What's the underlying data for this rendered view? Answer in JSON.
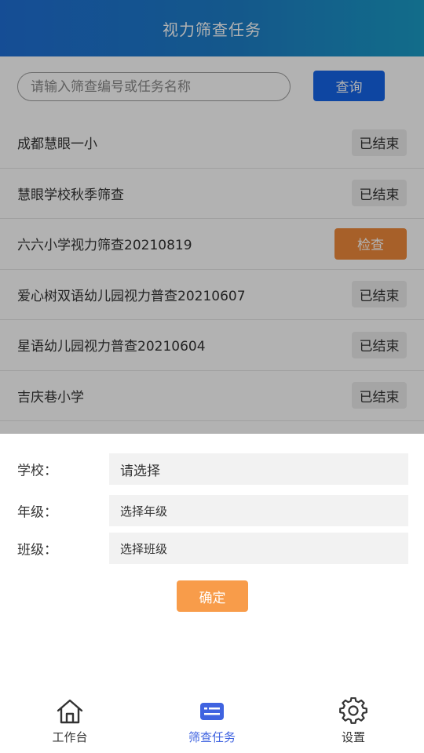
{
  "header": {
    "title": "视力筛查任务"
  },
  "search": {
    "placeholder": "请输入筛查编号或任务名称",
    "button_label": "查询"
  },
  "tasks": [
    {
      "name": "成都慧眼一小",
      "status": "已结束"
    },
    {
      "name": "慧眼学校秋季筛查",
      "status": "已结束"
    },
    {
      "name": "六六小学视力筛查20210819",
      "status": "检查"
    },
    {
      "name": "爱心树双语幼儿园视力普查20210607",
      "status": "已结束"
    },
    {
      "name": "星语幼儿园视力普查20210604",
      "status": "已结束"
    },
    {
      "name": "吉庆巷小学",
      "status": "已结束"
    }
  ],
  "sheet": {
    "school": {
      "label": "学校：",
      "value": "请选择"
    },
    "grade": {
      "label": "年级：",
      "value": "选择年级"
    },
    "class": {
      "label": "班级：",
      "value": "选择班级"
    },
    "confirm_label": "确定"
  },
  "tabbar": {
    "items": [
      {
        "label": "工作台",
        "icon": "home-icon"
      },
      {
        "label": "筛查任务",
        "icon": "task-card-icon",
        "active": true
      },
      {
        "label": "设置",
        "icon": "gear-icon"
      }
    ]
  },
  "colors": {
    "primary": "#1565e8",
    "accent": "#f08a3c",
    "active_tab": "#3f63e0"
  }
}
